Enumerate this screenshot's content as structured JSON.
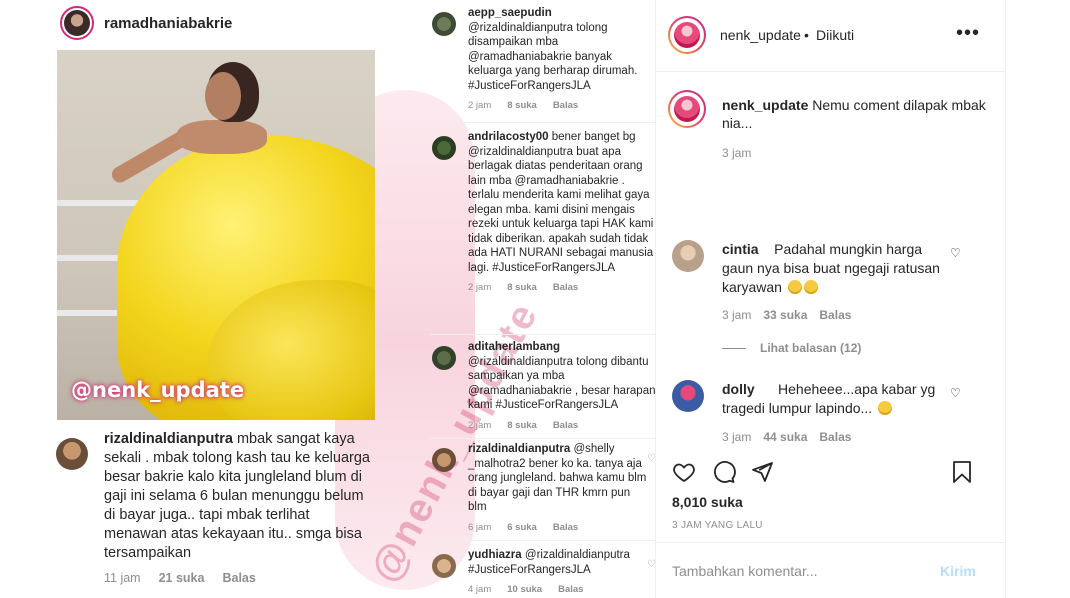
{
  "post": {
    "left_card": {
      "username": "ramadhaniabakrie",
      "photo_tag": "@nenk_update",
      "comment": {
        "username": "rizaldinaldianputra",
        "text": "mbak sangat kaya sekali . mbak tolong kash tau ke keluarga besar bakrie kalo kita jungleland blum di gaji ini selama 6 bulan menunggu belum di bayar juga.. tapi mbak terlihat menawan atas kekayaan itu.. smga bisa tersampaikan",
        "time": "11 jam",
        "likes": "21 suka",
        "reply": "Balas"
      }
    },
    "watermark": "@nenk_update",
    "right_comments": [
      {
        "username": "aepp_saepudin",
        "text": "@rizaldinaldianputra tolong disampaikan mba @ramadhaniabakrie banyak keluarga yang berharap dirumah. #JusticeForRangersJLA",
        "time": "2 jam",
        "likes": "8 suka",
        "reply": "Balas"
      },
      {
        "username": "andrilacosty00",
        "text": "bener banget bg @rizaldinaldianputra buat apa berlagak diatas penderitaan orang lain mba @ramadhaniabakrie . terlalu menderita kami melihat gaya elegan mba. kami disini mengais rezeki untuk keluarga tapi HAK kami tidak diberikan. apakah sudah tidak ada HATI NURANI sebagai manusia lagi. #JusticeForRangersJLA",
        "time": "2 jam",
        "likes": "8 suka",
        "reply": "Balas"
      },
      {
        "username": "aditaherlambang",
        "text": "@rizaldinaldianputra tolong dibantu sampaikan ya mba @ramadhaniabakrie , besar harapan kami #JusticeForRangersJLA",
        "time": "2 jam",
        "likes": "8 suka",
        "reply": "Balas"
      },
      {
        "username": "rizaldinaldianputra",
        "text": "@shelly _malhotra2 bener ko ka. tanya aja orang jungleland. bahwa kamu blm di bayar gaji dan THR kmrn pun blm",
        "time": "6 jam",
        "likes": "6 suka",
        "reply": "Balas"
      },
      {
        "username": "yudhiazra",
        "text": "@rizaldinaldianputra #JusticeForRangersJLA",
        "time": "4 jam",
        "likes": "10 suka",
        "reply": "Balas"
      }
    ]
  },
  "sidebar": {
    "header": {
      "username": "nenk_update",
      "dot": "•",
      "follow_label": "Diikuti",
      "more": "•••"
    },
    "caption": {
      "username": "nenk_update",
      "text": "Nemu coment dilapak mbak nia...",
      "time": "3 jam"
    },
    "comments": [
      {
        "username": "cintia",
        "text": "Padahal mungkin harga gaun nya bisa buat ngegaji ratusan karyawan",
        "time": "3 jam",
        "likes": "33 suka",
        "reply": "Balas",
        "view_replies": "Lihat balasan (12)"
      },
      {
        "username": "dolly",
        "text": "Heheheee...apa kabar yg tragedi lumpur lapindo...",
        "time": "3 jam",
        "likes": "44 suka",
        "reply": "Balas"
      }
    ],
    "like_count": "8,010 suka",
    "post_time": "3 JAM YANG LALU",
    "composer": {
      "placeholder": "Tambahkan komentar...",
      "send_label": "Kirim"
    },
    "icons": {
      "like": "heart-icon",
      "comment": "comment-icon",
      "share": "share-icon",
      "save": "bookmark-icon"
    }
  }
}
